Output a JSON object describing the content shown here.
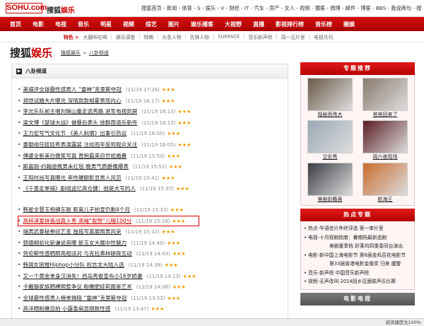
{
  "header": {
    "logo": "SOHU.com",
    "site_prefix": "搜狐",
    "site_suffix": "娱乐",
    "top_links": "搜狐首页 - 新闻 - 体育 - S - 娱乐 - V - 财经 - IT - 汽车 - 房产 - 女人 - 视频 - 播客 - 微博 - 邮件 - 博客 - BBS - 我说两句 - 搜狗"
  },
  "main_nav": [
    "首页",
    "电影",
    "电视",
    "音乐",
    "明星",
    "视频",
    "综艺",
    "图片",
    "娱乐播客",
    "大视野",
    "直播",
    "影视排行榜",
    "音乐榜",
    "圈娱"
  ],
  "sub_nav": {
    "featured": "特色 >",
    "items": [
      "大翻布吃喝",
      "娱乐调查",
      "特稿",
      "头条人物",
      "先锋人物",
      "SURFACE",
      "音乐新声榜",
      "周一见片室",
      "电视月刊"
    ]
  },
  "channel": {
    "logo_prefix": "搜狐",
    "logo_suffix": "娱乐",
    "crumb_1": "搜狐娱乐",
    "crumb_sep": ">",
    "crumb_2": "八卦频道"
  },
  "section": {
    "icon": "▶",
    "title": "八卦频道"
  },
  "news_group_1": [
    {
      "title": "美媒评全球最性感男人 “雷神”克里斯夺冠",
      "date": "(11/19 17:26)",
      "stars": "★★★"
    },
    {
      "title": "郑恺试婚大片曝光 深情款款相霍表现内心",
      "date": "(11/19 16:17)",
      "stars": "★★★"
    },
    {
      "title": "李光乐队前主唱刘琳山重走选秀路 进军电视荧屏",
      "date": "(11/19 16:13)",
      "stars": "★★★"
    },
    {
      "title": "梁文博《楚球大战》做暴后表头 徐群雨语乐新传",
      "date": "(11/19 16:13)",
      "stars": "★★★"
    },
    {
      "title": "王力宏写气文化节 《美人刺猬》出事引热议",
      "date": "(11/19 16:05)",
      "stars": "★★★"
    },
    {
      "title": "泰勒组任娃娃秀表演露装 注绞而年受到观众关注",
      "date": "(11/19 16:05)",
      "stars": "★★★"
    },
    {
      "title": "傅婆全新美白微笑写真 曾抱霸英自世纸婚慕",
      "date": "(11/19 15:53)",
      "stars": "★★★"
    },
    {
      "title": "斯嘉丽-约翰逊携男未红毯 晚男气质爵儒爆表",
      "date": "(11/19 15:52)",
      "stars": "★★★"
    },
    {
      "title": "王阳时尚写真曝光 率性硬朗彰显男人风范",
      "date": "(11/19 15:41)",
      "stars": "★★★"
    },
    {
      "title": "《千里走单骑》剧组追忆高仓健：他是大写的人",
      "date": "(11/19 15:37)",
      "stars": "★★★"
    }
  ],
  "news_group_2": [
    {
      "title": "韩星全慧玉抱拂东刚 距离儿子拍宣仍剩4个月",
      "date": "(11/19 15:33)",
      "stars": "★★★"
    },
    {
      "title": "高梓淇爱拼首战真人秀 高喊“叙赞”儿哦100分",
      "date": "(11/19 15:18)",
      "stars": "★★★",
      "highlight": true
    },
    {
      "title": "嗨男武泰秘参综艺变 独揽写真展照男风采",
      "date": "(11/19 15:12)",
      "stars": "★★★"
    },
    {
      "title": "郭德纲初化斩谦说首曝 新玉女大展中性魅力",
      "date": "(11/19 14:49)",
      "stars": "★★★"
    },
    {
      "title": "劳伦斯性感晒照亮相派对 与克拉弗林碳夜互动",
      "date": "(11/19 14:43)",
      "stars": "★★★"
    },
    {
      "title": "韩国女团推Hiphop小分队 权志龙大陆入选",
      "date": "(11/19 14:38)",
      "stars": "★★★"
    },
    {
      "title": "又一个黄金单身汉消失！西岛秀俊宣布小16岁娇妻",
      "date": "(11/19 14:13)",
      "stars": "★★★"
    },
    {
      "title": "卡戴珊家族晒裸照惹争议 粉嫩肥娃莉面是艺术",
      "date": "(11/19 14:06)",
      "stars": "★★★"
    },
    {
      "title": "全球最性感男人榜单揭晓 “雷神”克里斯夺冠",
      "date": "(11/19 13:53)",
      "stars": "★★★"
    },
    {
      "title": "高洋晒粉嫩自拍 小露香肩显刚致性感",
      "date": "(11/19 13:47)",
      "stars": "★★★"
    }
  ],
  "right": {
    "topic_title": "专题推荐",
    "thumbs": [
      {
        "caption": "隐秘而伟大",
        "color": "#6a5a48"
      },
      {
        "caption": "爸爸回来了",
        "color": "#8a7b6e"
      },
      {
        "caption": "艾伦秀",
        "color": "#9aa9b6"
      },
      {
        "caption": "周六夜现场",
        "color": "#5a1c24"
      },
      {
        "caption": "美剧前瞻表",
        "color": "#3b3d44"
      },
      {
        "caption": "航海王",
        "color": "#c96b2e"
      }
    ],
    "hot_title": "热点专题",
    "hot_items": [
      {
        "text": "热点-华语佳片年终评选 第一审片室",
        "sub": false
      },
      {
        "text": "电视-十月观剧指南：暑期档最新追剧",
        "sub": false
      },
      {
        "text": "美剧夏季档 好莱坞四重奏同台演出",
        "sub": true
      },
      {
        "text": "电影-新中国上海电影节 第6届金鸡百花电影节",
        "sub": false
      },
      {
        "text": "第33届香港电影金像奖 归来 魔警",
        "sub": true
      },
      {
        "text": "音乐-新声榜 中国音乐新声榜",
        "sub": false
      },
      {
        "text": "视频-无声改叫 2014回乡见面联声乐比赛",
        "sub": false
      }
    ],
    "tv_title": "电影电视"
  },
  "status": {
    "left": "",
    "right": "阅读器医生",
    "zoom": "100%"
  }
}
